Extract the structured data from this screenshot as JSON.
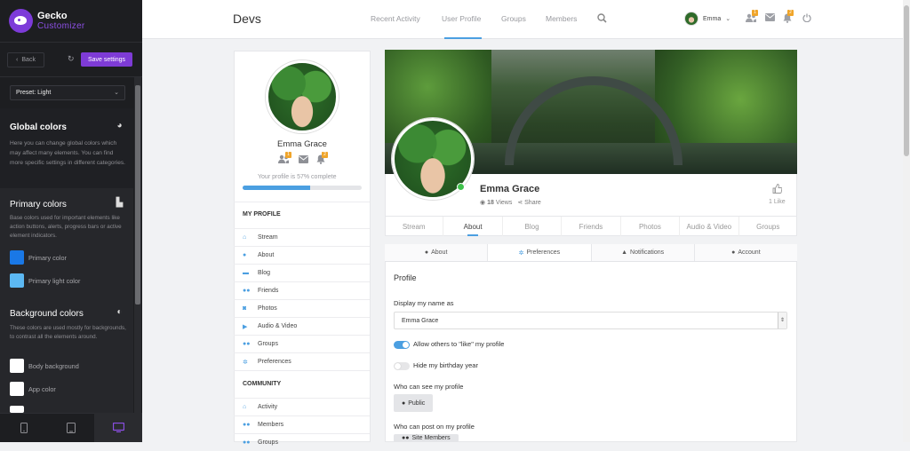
{
  "customizer": {
    "brand_name": "Gecko",
    "brand_sub": "Customizer",
    "back_label": "Back",
    "save_label": "Save settings",
    "preset": "Preset: Light",
    "global_title": "Global colors",
    "global_desc": "Here you can change global colors which may affect many elements. You can find more specific settings in different categories.",
    "primary_title": "Primary colors",
    "primary_desc": "Base colors used for important elements like action buttons, alerts, progress bars or active element indicators.",
    "primary_color_label": "Primary color",
    "primary_light_label": "Primary light color",
    "primary_color": "#1a78e6",
    "primary_light_color": "#5cb8f2",
    "background_title": "Background colors",
    "background_desc": "These colors are used mostly for backgrounds, to contrast all the elements around.",
    "body_bg_label": "Body background",
    "app_color_label": "App color"
  },
  "site": {
    "title": "Devs",
    "nav": [
      "Recent Activity",
      "User Profile",
      "Groups",
      "Members"
    ],
    "user_name": "Emma",
    "friend_badge": "1",
    "notif_badge": "2"
  },
  "profile_card": {
    "name": "Emma Grace",
    "progress_text": "Your profile is 57% complete",
    "progress_value": 57,
    "my_profile_header": "MY PROFILE",
    "menu": [
      "Stream",
      "About",
      "Blog",
      "Friends",
      "Photos",
      "Audio & Video",
      "Groups",
      "Preferences"
    ],
    "community_header": "COMMUNITY",
    "community_menu": [
      "Activity",
      "Members",
      "Groups"
    ]
  },
  "cover": {
    "name": "Emma Grace",
    "views_count": "18",
    "views_label": "Views",
    "share_label": "Share",
    "like_text": "1 Like"
  },
  "profile_tabs": [
    "Stream",
    "About",
    "Blog",
    "Friends",
    "Photos",
    "Audio & Video",
    "Groups"
  ],
  "sub_tabs": [
    "About",
    "Preferences",
    "Notifications",
    "Account"
  ],
  "form": {
    "title": "Profile",
    "display_label": "Display my name as",
    "display_value": "Emma Grace",
    "toggle1_label": "Allow others to \"like\" my profile",
    "toggle2_label": "Hide my birthday year",
    "see_label": "Who can see my profile",
    "see_value": "Public",
    "post_label": "Who can post on my profile",
    "post_value": "Site Members"
  }
}
